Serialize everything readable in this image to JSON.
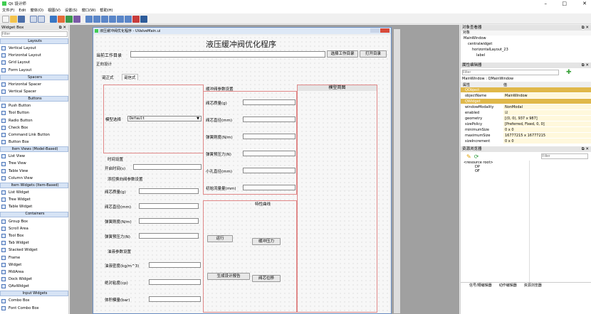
{
  "app": {
    "title": "Qt 设计师",
    "minimize": "–",
    "maximize": "□",
    "close": "✕"
  },
  "menu": [
    "文件(F)",
    "Edit",
    "窗体(O)",
    "视图(V)",
    "设置(S)",
    "窗口(W)",
    "帮助(H)"
  ],
  "widget_box": {
    "title": "Widget Box",
    "filter_placeholder": "Filter",
    "sections": [
      {
        "name": "Layouts",
        "items": [
          "Vertical Layout",
          "Horizontal Layout",
          "Grid Layout",
          "Form Layout"
        ]
      },
      {
        "name": "Spacers",
        "items": [
          "Horizontal Spacer",
          "Vertical Spacer"
        ]
      },
      {
        "name": "Buttons",
        "items": [
          "Push Button",
          "Tool Button",
          "Radio Button",
          "Check Box",
          "Command Link Button",
          "Button Box"
        ]
      },
      {
        "name": "Item Views (Model-Based)",
        "items": [
          "List View",
          "Tree View",
          "Table View",
          "Column View"
        ]
      },
      {
        "name": "Item Widgets (Item-Based)",
        "items": [
          "List Widget",
          "Tree Widget",
          "Table Widget"
        ]
      },
      {
        "name": "Containers",
        "items": [
          "Group Box",
          "Scroll Area",
          "Tool Box",
          "Tab Widget",
          "Stacked Widget",
          "Frame",
          "Widget",
          "MdiArea",
          "Dock Widget",
          "QAxWidget"
        ]
      },
      {
        "name": "Input Widgets",
        "items": [
          "Combo Box",
          "Font Combo Box"
        ]
      }
    ]
  },
  "form": {
    "window_title": "液压缓冲阀优化程序 - UValveMain.ui",
    "heading": "液压缓冲阀优化程序",
    "workdir_label": "当前工作目录",
    "btn_select_dir": "选择工作目录",
    "btn_open_dir": "打开目录",
    "forward_design": "正向设计",
    "tabs": [
      "诞正式",
      "诞信式"
    ],
    "model_select_label": "模型选择",
    "model_select_value": "Default",
    "timing_title": "时间设置",
    "open_time": "开启时间(s)",
    "fwd_params_title": "添控换向阀参数设置",
    "fwd_fields": [
      "阀芯质量(g)",
      "阀芯直径(mm)",
      "弹簧刚度(N/m)",
      "弹簧预压力(N)"
    ],
    "oil_title": "油液参数设置",
    "oil_fields": [
      "油液密度(kg/m^3)",
      "绝对粘度(cp)",
      "体积模量(bar)"
    ],
    "buf_title": "缓冲阀参数设置",
    "buf_fields": [
      "阀芯质量(g)",
      "阀芯直径(mm)",
      "弹簧刚度(N/m)",
      "弹簧预压力(N)",
      "小孔直径(mm)",
      "初始流量量(mm)"
    ],
    "model_diagram": "模型简图",
    "curve_title": "特性曲线",
    "btn_run": "运行",
    "btn_pressure": "缓冲压力",
    "btn_report": "生成设计报告",
    "btn_disp": "阀芯位移"
  },
  "object_inspector": {
    "title": "对象查看器",
    "col": "对象",
    "nodes": [
      "MainWindow",
      "centralwidget",
      "horizontalLayout_23",
      "label"
    ]
  },
  "property_editor": {
    "title": "属性编辑器",
    "filter_placeholder": "Filter",
    "context": "MainWindow : QMainWindow",
    "col_prop": "属性",
    "col_val": "值",
    "rows": [
      {
        "k": "QObject",
        "v": "",
        "cat": true
      },
      {
        "k": "objectName",
        "v": "MainWindow"
      },
      {
        "k": "QWidget",
        "v": "",
        "cat": true
      },
      {
        "k": "windowModality",
        "v": "NonModal"
      },
      {
        "k": "enabled",
        "v": "☑"
      },
      {
        "k": "geometry",
        "v": "[(0, 0), 937 x 987]"
      },
      {
        "k": "sizePolicy",
        "v": "[Preferred, Fixed, 0, 0]"
      },
      {
        "k": "minimumSize",
        "v": "0 x 0"
      },
      {
        "k": "maximumSize",
        "v": "16777215 x 16777215"
      },
      {
        "k": "sizeIncrement",
        "v": "0 x 0"
      }
    ]
  },
  "resource_browser": {
    "title": "资源浏览器",
    "filter_placeholder": "Filter",
    "root": "<resource root>",
    "items": [
      "DP",
      "OF"
    ]
  },
  "bottom_tabs": [
    "信号/槽编辑器",
    "动作编辑器",
    "资源浏览器"
  ]
}
